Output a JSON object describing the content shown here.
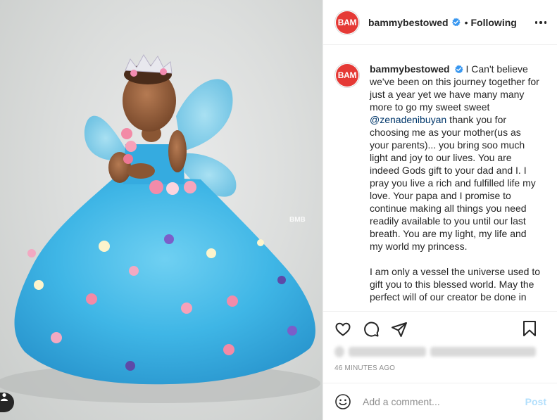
{
  "photo": {
    "alt_subject": "girl-in-blue-tulle-gown-with-fairy-wings",
    "watermark": "BMB",
    "colors": {
      "gown": "#3fb6e6",
      "backdrop": "#d8dad9"
    }
  },
  "header": {
    "avatar_text": "BAM",
    "username": "bammybestowed",
    "separator": "•",
    "follow_status": "Following"
  },
  "caption": {
    "avatar_text": "BAM",
    "username": "bammybestowed",
    "text_before_mention": " I Can't believe we've been on this journey together for just a year yet we have many many more to go my sweet sweet ",
    "mention": "@zenadenibuyan",
    "text_after_mention": " thank you for choosing me as your mother(us as your parents)... you bring soo much light and joy to our lives. You are indeed Gods gift to your dad and I. I pray you live a rich and fulfilled life my love. Your papa and I promise to continue making all things you need readily available to you until our last breath. You are my light, my life and my world my princess.\n\nI am only a vessel the universe used to gift you to this blessed world. May the perfect will of our creator be done in"
  },
  "actions": {
    "like_icon": "heart-icon",
    "comment_icon": "comment-icon",
    "share_icon": "paper-plane-icon",
    "save_icon": "bookmark-icon"
  },
  "timestamp": "46 MINUTES AGO",
  "comment_bar": {
    "emoji_icon": "smiley-icon",
    "placeholder": "Add a comment...",
    "post_label": "Post"
  },
  "colors": {
    "verified": "#3897f0",
    "avatar_bg": "#e53935",
    "mention": "#00376b",
    "post_disabled": "#b2dffc",
    "divider": "#efefef"
  }
}
